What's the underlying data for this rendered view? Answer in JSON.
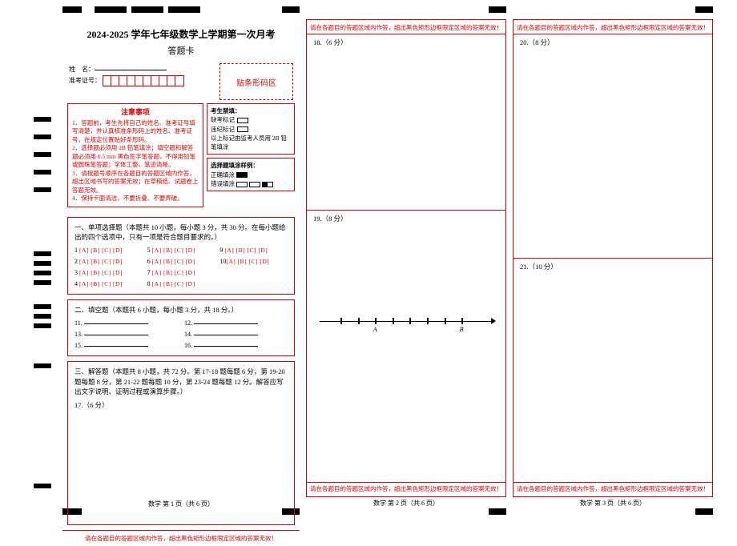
{
  "chart_data": null,
  "meta": {
    "title": "2024-2025 学年七年级数学上学期第一次月考",
    "subtitle": "答题卡"
  },
  "id_labels": {
    "name": "姓　名：",
    "ticket": "准考证号："
  },
  "barcode_label": "贴条形码区",
  "notice": {
    "heading": "注意事项",
    "items": [
      "1．答题前，考生先将自己的姓名、准考证号填写清楚，并认真核准条形码上的姓名、准考证号，在规定位置贴好条形码。",
      "2．选择题必须用 2B 铅笔填涂；填空题和解答题必须用 0.5 mm 黑色签字笔答题，不得用铅笔或圆珠笔答题；字体工整、笔迹清晰。",
      "3．请按题号顺序在各题目的答题区域内作答，超出区域书写的答案无效；在草稿纸、试题卷上答题无效。",
      "4．保持卡面清洁，不要折叠、不要弄破。"
    ]
  },
  "candidate_fill": {
    "title": "考生禁填：",
    "absent": "缺考标记",
    "violation": "违纪标记",
    "note": "以上标记由监考人员用 2B 铅笔填涂"
  },
  "sample": {
    "title": "选择题填涂样例：",
    "correct": "正确填涂",
    "wrong": "错误填涂"
  },
  "section1": {
    "heading": "一、单项选择题（本题共 10 小题，每小题 3 分，共 30 分。在每小题给出的四个选项中，只有一项是符合题目要求的。）",
    "nums": [
      "1",
      "2",
      "3",
      "4",
      "5",
      "6",
      "7",
      "8",
      "9",
      "10"
    ],
    "opts": "[A] [B] [C] [D]"
  },
  "section2": {
    "heading": "二、填空题（本题共 6 小题，每小题 3 分，共 18 分。）",
    "nums": [
      "11.",
      "12.",
      "13.",
      "14.",
      "15.",
      "16."
    ]
  },
  "section3": {
    "heading": "三、解答题（本题共 8 小题，共 72 分。第 17-18 题每题 6 分，第 19-20 题每题 8 分，第 21-22 题每题 10 分，第 23-24 题每题 12 分。解答应写出文字说明、证明过程或演算步骤。）",
    "q17": "17.（6 分）"
  },
  "warn": "请在各题目的答题区域内作答，超出黑色矩形边框限定区域的答案无效！",
  "page_footers": {
    "p1": "数学 第 1 页（共 6 页）",
    "p2": "数学 第 2 页（共 6 页）",
    "p3": "数学 第 3 页（共 6 页）"
  },
  "p2": {
    "q18": "18.（6 分）",
    "q19": "19.（8 分）",
    "axis": {
      "A": "A",
      "B": "B"
    }
  },
  "p3": {
    "q20": "20.（8 分）",
    "q21": "21.（10 分）"
  }
}
